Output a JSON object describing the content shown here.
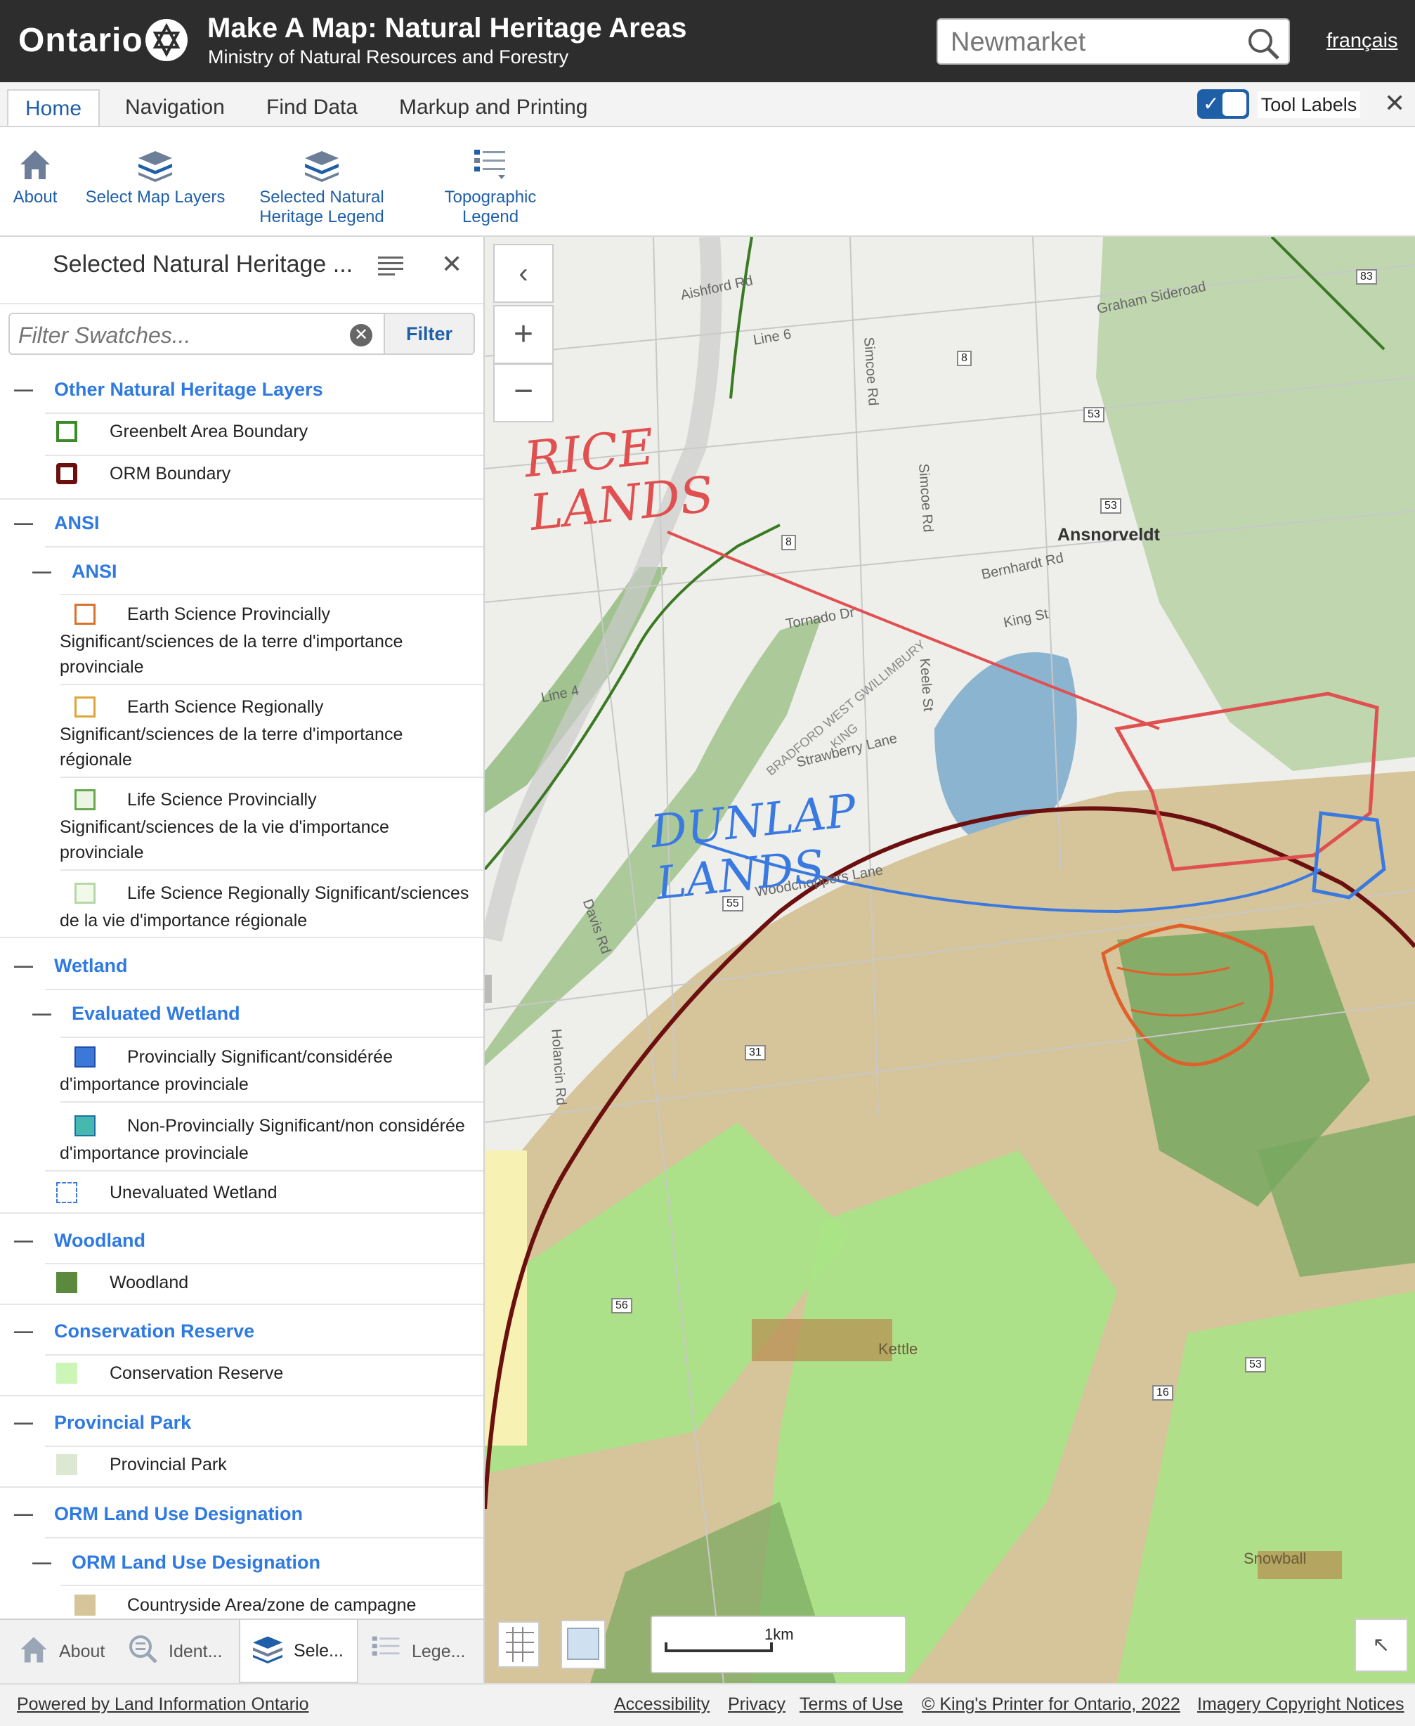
{
  "header": {
    "logo": "Ontario",
    "title": "Make A Map: Natural Heritage Areas",
    "subtitle": "Ministry of Natural Resources and Forestry",
    "search_value": "Newmarket",
    "language_link": "français"
  },
  "tabs": [
    "Home",
    "Navigation",
    "Find Data",
    "Markup and Printing"
  ],
  "active_tab": "Home",
  "tool_labels": {
    "label": "Tool Labels",
    "checked": true
  },
  "ribbon": [
    {
      "label": "About",
      "icon": "home-icon"
    },
    {
      "label": "Select Map Layers",
      "icon": "layers-icon"
    },
    {
      "label": "Selected Natural Heritage Legend",
      "icon": "layers-icon"
    },
    {
      "label": "Topographic Legend",
      "icon": "legend-list-icon"
    }
  ],
  "panel": {
    "title": "Selected Natural Heritage ...",
    "filter_placeholder": "Filter Swatches...",
    "filter_button": "Filter",
    "sections": [
      {
        "label": "Other Natural Heritage Layers"
      },
      {
        "label": "ANSI"
      },
      {
        "label": "ANSI"
      },
      {
        "label": "Wetland"
      },
      {
        "label": "Evaluated Wetland"
      },
      {
        "label": "Woodland"
      },
      {
        "label": "Conservation Reserve"
      },
      {
        "label": "Provincial Park"
      },
      {
        "label": "ORM Land Use Designation"
      },
      {
        "label": "ORM Land Use Designation"
      }
    ],
    "items": [
      {
        "label": "Greenbelt Area Boundary",
        "color": "#3a8a2a"
      },
      {
        "label": "ORM Boundary",
        "color": "#6b0f0f"
      },
      {
        "line1": "Earth Science Provincially",
        "line2": "Significant/sciences de la terre d'importance",
        "line3": "provinciale",
        "color": "#d9722a"
      },
      {
        "line1": "Earth Science Regionally",
        "line2": "Significant/sciences de la terre d'importance",
        "line3": "régionale",
        "color": "#e0a53a"
      },
      {
        "line1": "Life Science Provincially",
        "line2": "Significant/sciences de la vie d'importance",
        "line3": "provinciale",
        "color": "#6aa84f"
      },
      {
        "line1": "Life Science Regionally Significant/sciences",
        "line2": "de la vie d'importance régionale",
        "color": "#b6d7a8"
      },
      {
        "line1": "Provincially Significant/considérée",
        "line2": "d'importance provinciale",
        "color": "#3c78d8"
      },
      {
        "line1": "Non-Provincially Significant/non considérée",
        "line2": "d'importance provinciale",
        "color": "#45b8b0"
      },
      {
        "label": "Unevaluated Wetland",
        "color": "#3c78d8"
      },
      {
        "label": "Woodland",
        "color": "#5b8a3f"
      },
      {
        "label": "Conservation Reserve",
        "color": "#ccf5b8"
      },
      {
        "label": "Provincial Park",
        "color": "#dde8d2"
      },
      {
        "label": "Countryside Area/zone de campagne",
        "color": "#d6c49a"
      }
    ]
  },
  "bottom_tabs": [
    "About",
    "Ident...",
    "Sele...",
    "Lege..."
  ],
  "map": {
    "place_labels": [
      "Ansnorveldt",
      "Kettle",
      "Snowball"
    ],
    "road_labels": [
      "Aishford Rd",
      "Line 6",
      "Simcoe Rd",
      "Simcoe Rd",
      "Bernhardt Rd",
      "Tornado Dr",
      "King St",
      "Line 4",
      "Keele St",
      "Strawberry Lane",
      "Woodchoppers Lane",
      "Davis Rd",
      "Holancin Rd",
      "Graham Sideroad",
      "BRADFORD WEST GWILLIMBURY",
      "KING"
    ],
    "route_shields": [
      "8",
      "53",
      "53",
      "8",
      "83",
      "55",
      "31",
      "56",
      "16",
      "53"
    ],
    "annotations": [
      "RICE LANDS",
      "DUNLAP LANDS"
    ],
    "scale_label": "1km"
  },
  "footer": {
    "powered": "Powered by Land Information Ontario",
    "links": [
      "Accessibility",
      "Privacy",
      "Terms of Use",
      "© King's Printer for Ontario, 2022",
      "Imagery Copyright Notices"
    ]
  },
  "colors": {
    "brand_dark": "#2d2d2d",
    "link_blue": "#2f7ae0",
    "accent": "#1f5fa8"
  }
}
